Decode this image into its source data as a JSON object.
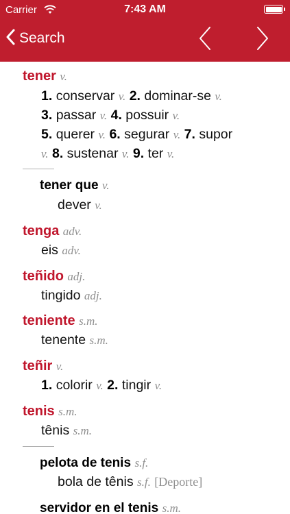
{
  "status_bar": {
    "carrier": "Carrier",
    "time": "7:43 AM"
  },
  "nav": {
    "back_label": "Search"
  },
  "entries": {
    "tener": {
      "headword": "tener",
      "pos": "v.",
      "senses": [
        {
          "n": "1.",
          "t": "conservar",
          "p": "v."
        },
        {
          "n": "2.",
          "t": "dominar-se",
          "p": "v."
        },
        {
          "n": "3.",
          "t": "passar",
          "p": "v."
        },
        {
          "n": "4.",
          "t": "possuir",
          "p": "v."
        },
        {
          "n": "5.",
          "t": "querer",
          "p": "v."
        },
        {
          "n": "6.",
          "t": "segurar",
          "p": "v."
        },
        {
          "n": "7.",
          "t": "supor",
          "p": "v."
        },
        {
          "n": "8.",
          "t": "sustenar",
          "p": "v."
        },
        {
          "n": "9.",
          "t": "ter",
          "p": "v."
        }
      ],
      "sub": {
        "phrase": "tener que",
        "pos": "v.",
        "translation": "dever",
        "tpos": "v."
      }
    },
    "tenga": {
      "headword": "tenga",
      "pos": "adv.",
      "translation": "eis",
      "tpos": "adv."
    },
    "tenido": {
      "headword": "teñido",
      "pos": "adj.",
      "translation": "tingido",
      "tpos": "adj."
    },
    "teniente": {
      "headword": "teniente",
      "pos": "s.m.",
      "translation": "tenente",
      "tpos": "s.m."
    },
    "tenir": {
      "headword": "teñir",
      "pos": "v.",
      "senses": [
        {
          "n": "1.",
          "t": "colorir",
          "p": "v."
        },
        {
          "n": "2.",
          "t": "tingir",
          "p": "v."
        }
      ]
    },
    "tenis": {
      "headword": "tenis",
      "pos": "s.m.",
      "translation": "tênis",
      "tpos": "s.m.",
      "subs": [
        {
          "phrase": "pelota de tenis",
          "pos": "s.f.",
          "translation": "bola de tênis",
          "tpos": "s.f.",
          "domain": "[Deporte]"
        },
        {
          "phrase": "servidor en el tenis",
          "pos": "s.m."
        }
      ]
    }
  }
}
